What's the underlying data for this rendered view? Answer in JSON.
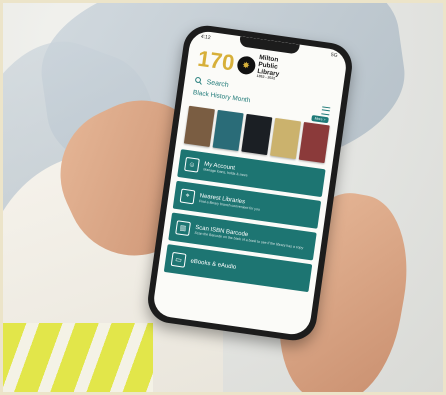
{
  "status": {
    "time": "4:12",
    "signal": "5G"
  },
  "logo": {
    "number": "170",
    "line1": "Milton",
    "line2": "Public",
    "line3": "Library",
    "years": "1852 - 2022"
  },
  "search": {
    "label": "Search"
  },
  "featured": {
    "title": "Black History Month",
    "more_label": "More >"
  },
  "books": [
    {
      "color": "#7a5d42"
    },
    {
      "color": "#2a6c78"
    },
    {
      "color": "#1b1f24"
    },
    {
      "color": "#cbb26d"
    },
    {
      "color": "#8b3a3a"
    }
  ],
  "tiles": [
    {
      "icon": "person-card-icon",
      "title": "My Account",
      "subtitle": "Manage loans, holds & more"
    },
    {
      "icon": "map-pin-icon",
      "title": "Nearest Libraries",
      "subtitle": "Find a library branch convenient for you"
    },
    {
      "icon": "barcode-icon",
      "title": "Scan ISBN Barcode",
      "subtitle": "Scan the Barcode on the back of a book to see if the library has a copy"
    },
    {
      "icon": "ebook-icon",
      "title": "eBooks & eAudio",
      "subtitle": ""
    }
  ]
}
